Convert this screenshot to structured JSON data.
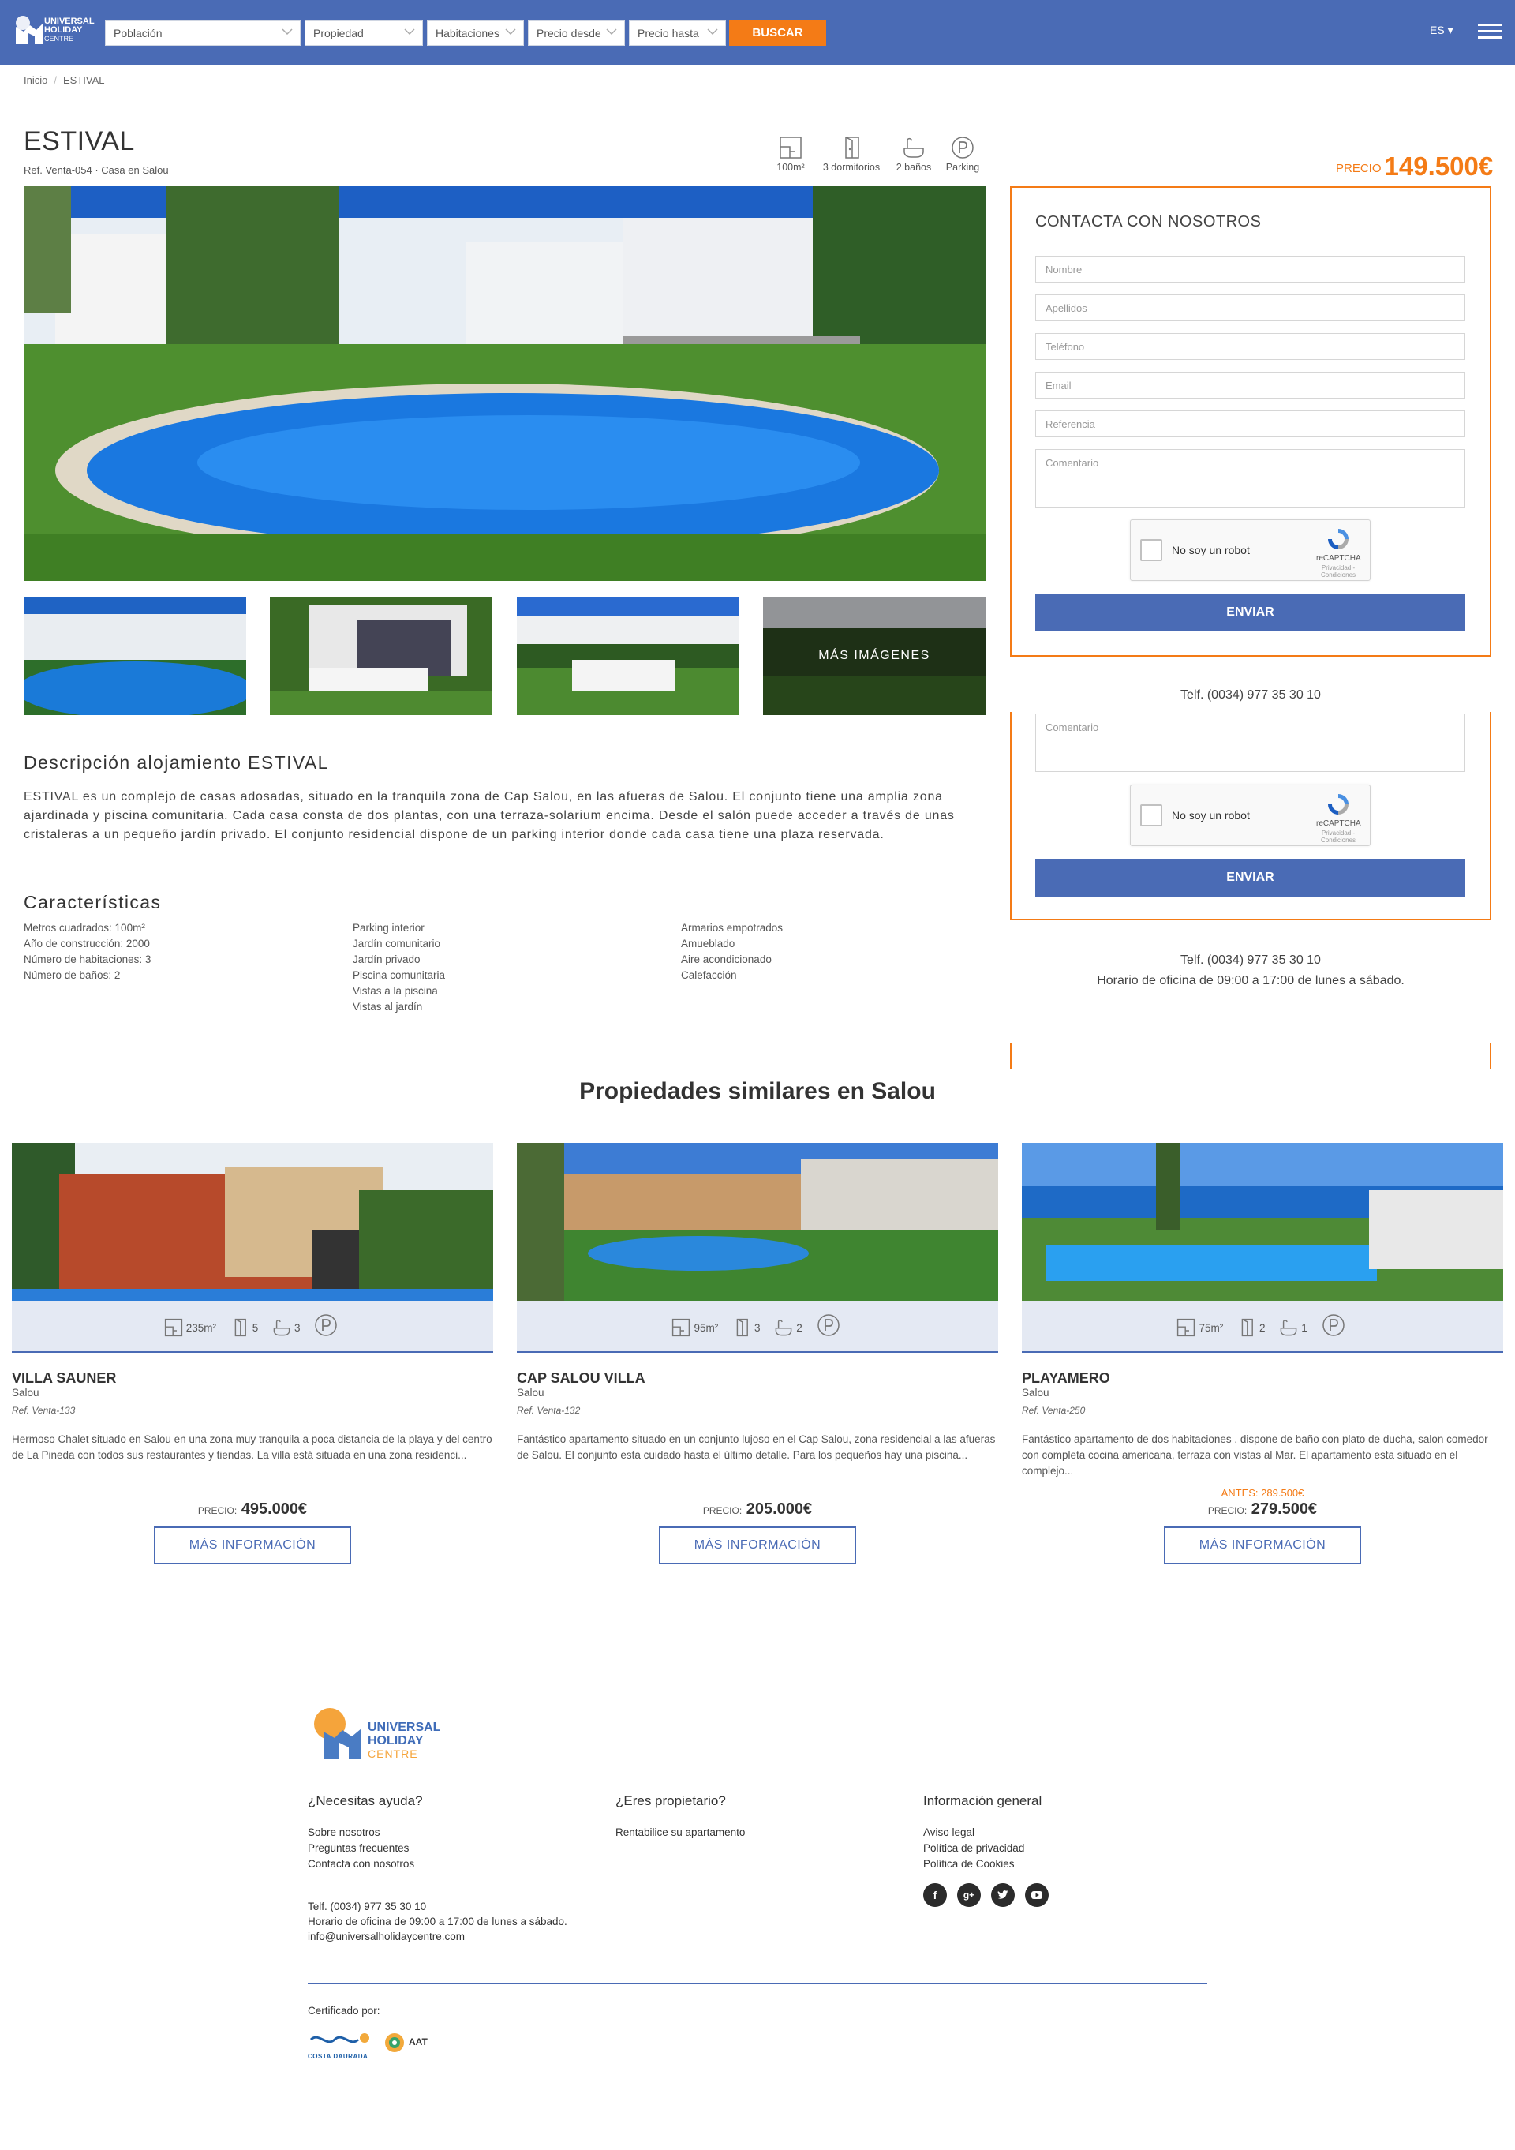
{
  "header": {
    "brand": {
      "line1": "UNIVERSAL",
      "line2": "HOLIDAY",
      "line3": "CENTRE"
    },
    "filters": [
      "Población",
      "Propiedad",
      "Habitaciones",
      "Precio desde",
      "Precio hasta"
    ],
    "search_button": "BUSCAR",
    "language": "ES ▾"
  },
  "breadcrumb": {
    "home": "Inicio",
    "separator": "/",
    "current": "ESTIVAL"
  },
  "property": {
    "title": "ESTIVAL",
    "ref": "Ref. Venta-054 · Casa en Salou",
    "features": [
      {
        "icon": "floor-plan-icon",
        "label": "100m²"
      },
      {
        "icon": "door-icon",
        "label": "3 dormitorios"
      },
      {
        "icon": "bath-icon",
        "label": "2 baños"
      },
      {
        "icon": "parking-icon",
        "label": "Parking"
      }
    ],
    "price_label": "PRECIO",
    "price": "149.500€",
    "more_images": "MÁS IMÁGENES"
  },
  "contact_form": {
    "title": "CONTACTA CON NOSOTROS",
    "placeholders": {
      "nombre": "Nombre",
      "apellidos": "Apellidos",
      "telefono": "Teléfono",
      "email": "Email",
      "referencia": "Referencia",
      "comentario": "Comentario"
    },
    "captcha": {
      "label": "No soy un robot",
      "brand": "reCAPTCHA",
      "privacy": "Privacidad - Condiciones"
    },
    "send": "ENVIAR",
    "phone": "Telf. (0034) 977 35 30 10",
    "hours": "Horario de oficina de 09:00 a 17:00 de lunes a sábado."
  },
  "description": {
    "title": "Descripción alojamiento ESTIVAL",
    "text": "ESTIVAL es un complejo de casas adosadas, situado en la tranquila zona de Cap Salou, en las afueras de Salou. El conjunto tiene una amplia zona ajardinada y piscina comunitaria. Cada casa consta de dos plantas, con una terraza-solarium encima. Desde el salón puede acceder a través de unas cristaleras a un pequeño jardín privado. El conjunto residencial dispone de un parking interior donde cada casa tiene una plaza reservada."
  },
  "characteristics": {
    "title": "Características",
    "col1": [
      "Metros cuadrados: 100m²",
      "Año de construcción: 2000",
      "Número de habitaciones: 3",
      "Número de baños: 2"
    ],
    "col2": [
      "Parking interior",
      "Jardín comunitario",
      "Jardín privado",
      "Piscina comunitaria",
      "Vistas a la piscina",
      "Vistas al jardín"
    ],
    "col3": [
      "Armarios empotrados",
      "Amueblado",
      "Aire acondicionado",
      "Calefacción"
    ]
  },
  "similar": {
    "title": "Propiedades similares en Salou",
    "cards": [
      {
        "name": "VILLA SAUNER",
        "city": "Salou",
        "ref": "Ref. Venta-133",
        "area": "235m²",
        "rooms": "5",
        "baths": "3",
        "desc": "Hermoso Chalet situado en Salou en una zona muy tranquila a poca distancia de la playa y del centro de La Pineda con todos sus restaurantes y tiendas. La villa está situada en una zona residenci...",
        "price_label": "PRECIO:",
        "price": "495.000€",
        "old_label": "",
        "old_price": "",
        "button": "MÁS INFORMACIÓN"
      },
      {
        "name": "CAP SALOU VILLA",
        "city": "Salou",
        "ref": "Ref. Venta-132",
        "area": "95m²",
        "rooms": "3",
        "baths": "2",
        "desc": "Fantástico apartamento situado en un conjunto lujoso en el Cap Salou, zona residencial a las afueras de Salou. El conjunto esta cuidado hasta el último detalle. Para los pequeños hay una piscina...",
        "price_label": "PRECIO:",
        "price": "205.000€",
        "old_label": "",
        "old_price": "",
        "button": "MÁS INFORMACIÓN"
      },
      {
        "name": "PLAYAMERO",
        "city": "Salou",
        "ref": "Ref. Venta-250",
        "area": "75m²",
        "rooms": "2",
        "baths": "1",
        "desc": "Fantástico apartamento de dos habitaciones , dispone de baño con plato de ducha, salon comedor con completa cocina americana, terraza con vistas al Mar. El apartamento esta situado en el complejo...",
        "price_label": "PRECIO:",
        "price": "279.500€",
        "old_label": "ANTES:",
        "old_price": "289.500€",
        "button": "MÁS INFORMACIÓN"
      }
    ]
  },
  "footer": {
    "brand": {
      "line1": "UNIVERSAL",
      "line2": "HOLIDAY",
      "line3": "CENTRE"
    },
    "help": {
      "title": "¿Necesitas ayuda?",
      "links": [
        "Sobre nosotros",
        "Preguntas frecuentes",
        "Contacta con nosotros"
      ]
    },
    "owner": {
      "title": "¿Eres propietario?",
      "links": [
        "Rentabilice su apartamento"
      ]
    },
    "info": {
      "title": "Información general",
      "links": [
        "Aviso legal",
        "Política de privacidad",
        "Política de Cookies"
      ]
    },
    "contact": [
      "Telf. (0034) 977 35 30 10",
      "Horario de oficina de 09:00 a 17:00 de lunes a sábado.",
      "info@universalholidaycentre.com"
    ],
    "certified": "Certificado por:",
    "cert_logos": [
      "COSTA DAURADA",
      "AAT"
    ],
    "social_icons": [
      "facebook-icon",
      "google-plus-icon",
      "twitter-icon",
      "youtube-icon"
    ]
  },
  "colors": {
    "header_blue": "#4a6bb5",
    "accent_orange": "#f47b16"
  }
}
